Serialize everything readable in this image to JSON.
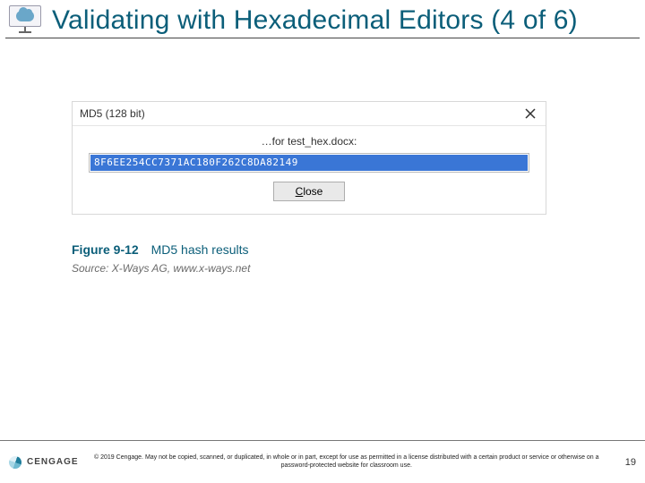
{
  "title": "Validating with Hexadecimal Editors (4 of 6)",
  "dialog": {
    "title": "MD5 (128 bit)",
    "for_line": "…for test_hex.docx:",
    "hash": "8F6EE254CC7371AC180F262C8DA82149",
    "close_label": "Close",
    "close_label_underline_char": "C",
    "close_label_rest": "lose"
  },
  "figure": {
    "number": "Figure 9-12",
    "title": "MD5 hash results",
    "source_prefix": "Source: X-Ways AG, ",
    "source_site": "www.x-ways.net"
  },
  "footer": {
    "brand": "CENGAGE",
    "copyright": "© 2019 Cengage. May not be copied, scanned, or duplicated, in whole or in part, except for use as permitted in a license distributed with a certain product or service or otherwise on a password-protected website for classroom use.",
    "page_number": "19"
  }
}
